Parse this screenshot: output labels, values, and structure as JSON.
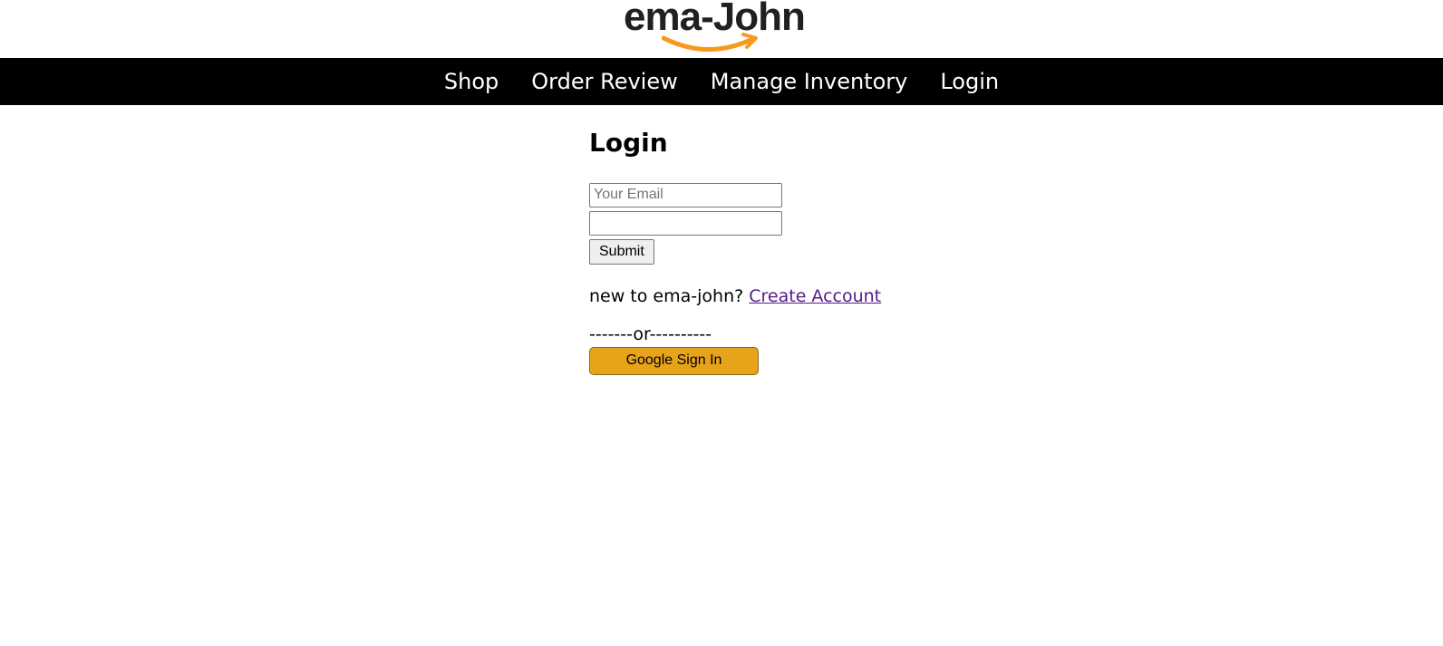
{
  "brand": {
    "logo_text": "ema-John",
    "logo_smile_color": "#f8991d"
  },
  "nav": {
    "items": [
      {
        "label": "Shop"
      },
      {
        "label": "Order Review"
      },
      {
        "label": "Manage Inventory"
      },
      {
        "label": "Login"
      }
    ]
  },
  "login": {
    "title": "Login",
    "email_placeholder": "Your Email",
    "email_value": "",
    "password_value": "",
    "submit_label": "Submit",
    "new_user_text": "new to ema-john?",
    "create_account_label": "Create Account",
    "divider_text": "-------or----------",
    "google_button_label": "Google Sign In",
    "google_button_color": "#e7a41a"
  }
}
